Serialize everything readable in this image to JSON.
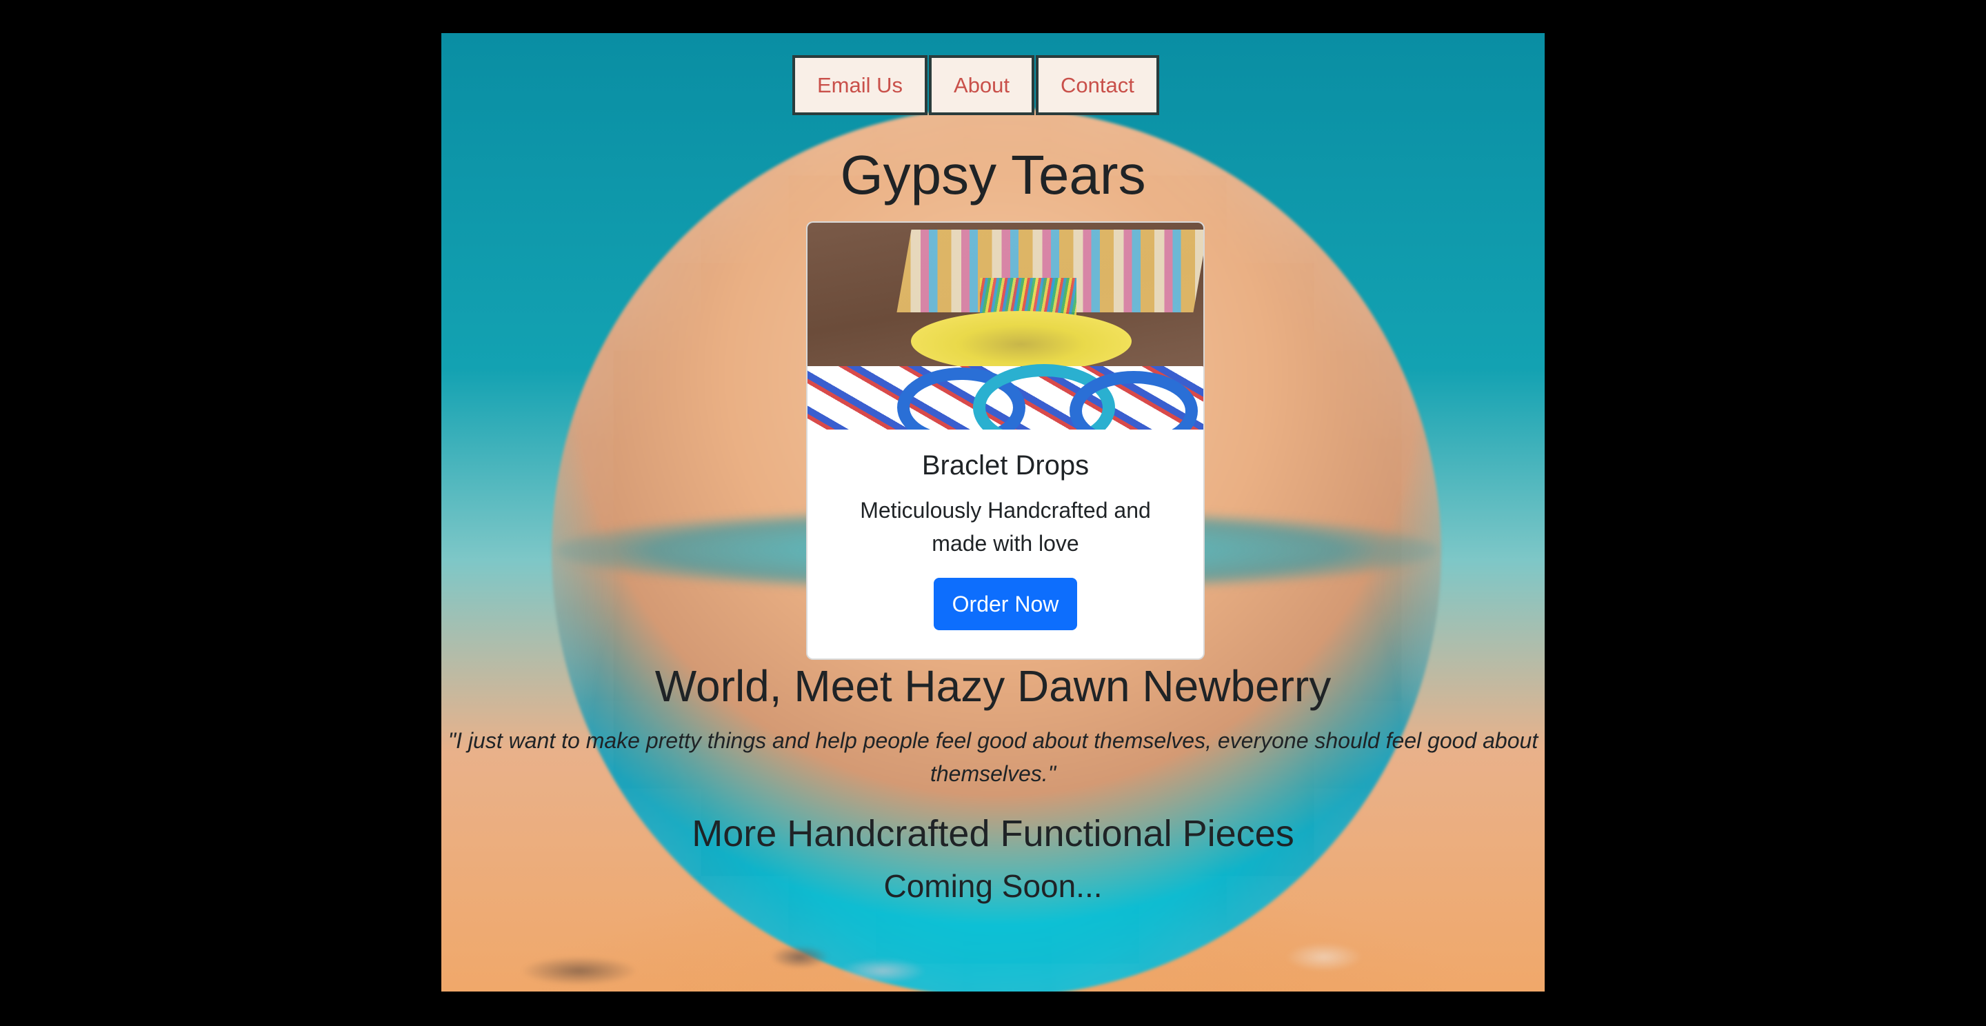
{
  "nav": {
    "items": [
      {
        "label": "Email Us"
      },
      {
        "label": "About"
      },
      {
        "label": "Contact"
      }
    ]
  },
  "site": {
    "title": "Gypsy Tears"
  },
  "card": {
    "image_alt": "Handcrafted beaded bracelets, scrunchie and fabric",
    "title": "Braclet Drops",
    "text": "Meticulously Handcrafted and made with love",
    "button_label": "Order Now"
  },
  "intro": {
    "heading": "World, Meet Hazy Dawn Newberry",
    "quote": "\"I just want to make pretty things and help people feel good about themselves, everyone should feel good about themselves.\""
  },
  "footer": {
    "more_heading": "More Handcrafted Functional Pieces",
    "coming_soon": "Coming Soon..."
  },
  "colors": {
    "page_bg": "#000000",
    "nav_bg": "#f9efe7",
    "nav_text": "#c9504a",
    "nav_border": "#2a3c3c",
    "primary_button": "#0d6efd",
    "heading_text": "#1f2326"
  }
}
